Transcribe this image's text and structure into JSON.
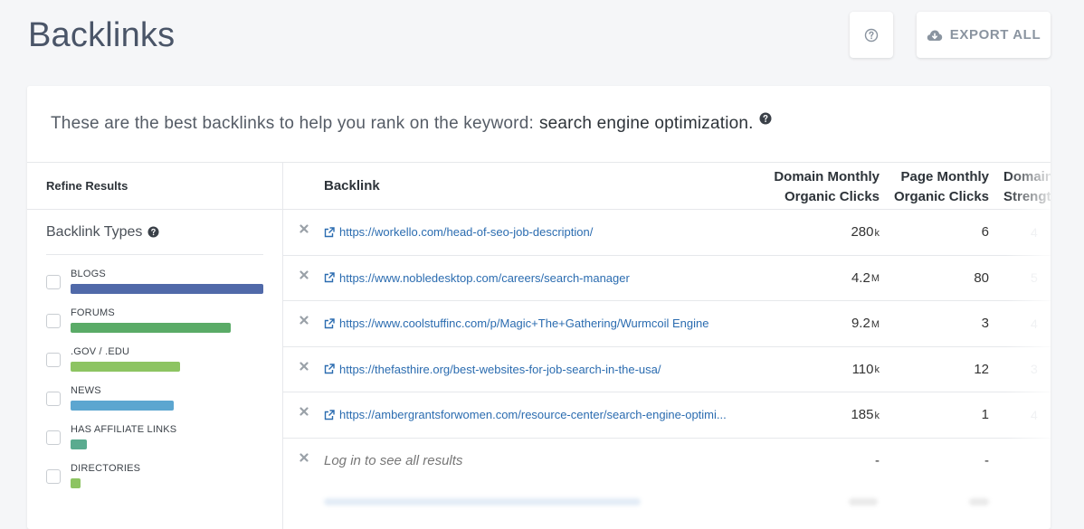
{
  "page": {
    "title": "Backlinks",
    "help_icon": "question-circle-icon",
    "export_label": "EXPORT ALL",
    "export_icon": "cloud-download-icon"
  },
  "card": {
    "intro_text": "These are the best backlinks to help you rank on the keyword:",
    "keyword": "search engine optimization."
  },
  "sidebar": {
    "refine_title": "Refine Results",
    "types_title": "Backlink Types",
    "types": [
      {
        "label": "BLOGS",
        "color": "#5069a9",
        "share": 1.0
      },
      {
        "label": "FORUMS",
        "color": "#5aab67",
        "share": 0.83
      },
      {
        "label": ".GOV / .EDU",
        "color": "#8dc462",
        "share": 0.566
      },
      {
        "label": "NEWS",
        "color": "#5ca6d0",
        "share": 0.535
      },
      {
        "label": "HAS AFFILIATE LINKS",
        "color": "#5aab8f",
        "share": 0.085
      },
      {
        "label": "DIRECTORIES",
        "color": "#8dc462",
        "share": 0.052
      }
    ]
  },
  "table": {
    "headers": {
      "backlink": "Backlink",
      "domain_monthly_1": "Domain Monthly",
      "domain_monthly_2": "Organic Clicks",
      "page_monthly_1": "Page Monthly",
      "page_monthly_2": "Organic Clicks",
      "domain_strength_1": "Domain",
      "domain_strength_2": "Strength"
    },
    "rows": [
      {
        "url": "https://workello.com/head-of-seo-job-description/",
        "domain_clicks": "280",
        "domain_unit": "k",
        "page_clicks": "6",
        "strength": "4"
      },
      {
        "url": "https://www.nobledesktop.com/careers/search-manager",
        "domain_clicks": "4.2",
        "domain_unit": "M",
        "page_clicks": "80",
        "strength": "5"
      },
      {
        "url": "https://www.coolstuffinc.com/p/Magic+The+Gathering/Wurmcoil Engine",
        "domain_clicks": "9.2",
        "domain_unit": "M",
        "page_clicks": "3",
        "strength": "4"
      },
      {
        "url": "https://thefasthire.org/best-websites-for-job-search-in-the-usa/",
        "domain_clicks": "110",
        "domain_unit": "k",
        "page_clicks": "12",
        "strength": "3"
      },
      {
        "url": "https://ambergrantsforwomen.com/resource-center/search-engine-optimi...",
        "domain_clicks": "185",
        "domain_unit": "k",
        "page_clicks": "1",
        "strength": "4"
      }
    ],
    "login_row": {
      "text": "Log in to see all results",
      "domain_clicks": "-",
      "page_clicks": "-"
    }
  }
}
